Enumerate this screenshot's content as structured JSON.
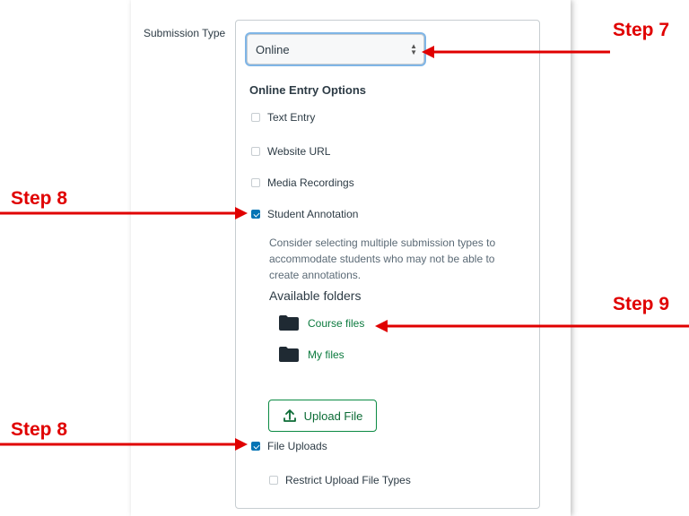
{
  "form": {
    "submission_type_label": "Submission Type",
    "select_value": "Online",
    "online_entry_heading": "Online Entry Options",
    "options": [
      {
        "label": "Text Entry",
        "checked": false
      },
      {
        "label": "Website URL",
        "checked": false
      },
      {
        "label": "Media Recordings",
        "checked": false
      },
      {
        "label": "Student Annotation",
        "checked": true
      }
    ],
    "annotation_hint": "Consider selecting multiple submission types to accommodate students who may not be able to create annotations.",
    "available_folders_label": "Available folders",
    "folders": [
      "Course files",
      "My files"
    ],
    "upload_button_label": "Upload File",
    "file_uploads_label": "File Uploads",
    "file_uploads_checked": true,
    "restrict_label": "Restrict Upload File Types",
    "restrict_checked": false
  },
  "annotations": {
    "step7": "Step 7",
    "step8_top": "Step 8",
    "step9": "Step 9",
    "step8_bottom": "Step 8"
  },
  "colors": {
    "annotation_red": "#e00000",
    "checkbox_blue": "#0374b5",
    "folder_link_green": "#0b7a3e"
  }
}
